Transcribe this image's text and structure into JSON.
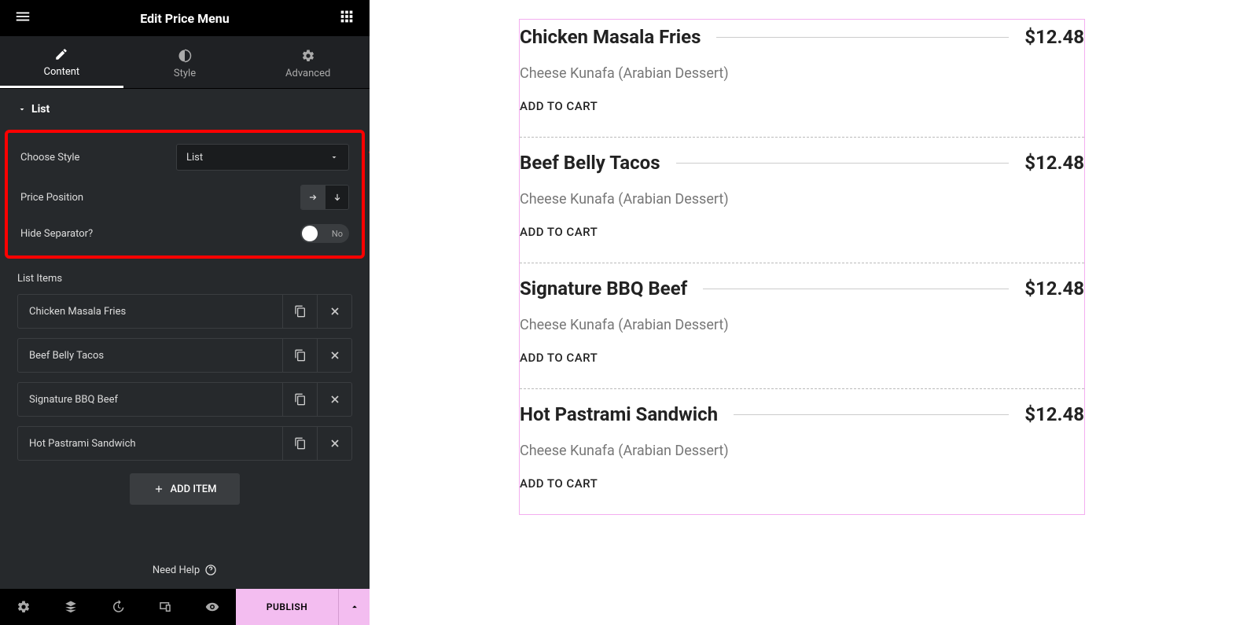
{
  "header": {
    "title": "Edit Price Menu"
  },
  "tabs": {
    "content": "Content",
    "style": "Style",
    "advanced": "Advanced"
  },
  "section": {
    "title": "List"
  },
  "controls": {
    "choose_style_label": "Choose Style",
    "choose_style_value": "List",
    "price_position_label": "Price Position",
    "hide_separator_label": "Hide Separator?",
    "hide_separator_value": "No"
  },
  "list_items_label": "List Items",
  "list_items": [
    {
      "name": "Chicken Masala Fries"
    },
    {
      "name": "Beef Belly Tacos"
    },
    {
      "name": "Signature BBQ Beef"
    },
    {
      "name": "Hot Pastrami Sandwich"
    }
  ],
  "add_item_label": "ADD ITEM",
  "need_help_label": "Need Help",
  "publish_label": "PUBLISH",
  "preview": {
    "items": [
      {
        "title": "Chicken Masala Fries",
        "price": "$12.48",
        "desc": "Cheese Kunafa (Arabian Dessert)",
        "cart": "ADD TO CART"
      },
      {
        "title": "Beef Belly Tacos",
        "price": "$12.48",
        "desc": "Cheese Kunafa (Arabian Dessert)",
        "cart": "ADD TO CART"
      },
      {
        "title": "Signature BBQ Beef",
        "price": "$12.48",
        "desc": "Cheese Kunafa (Arabian Dessert)",
        "cart": "ADD TO CART"
      },
      {
        "title": "Hot Pastrami Sandwich",
        "price": "$12.48",
        "desc": "Cheese Kunafa (Arabian Dessert)",
        "cart": "ADD TO CART"
      }
    ]
  }
}
